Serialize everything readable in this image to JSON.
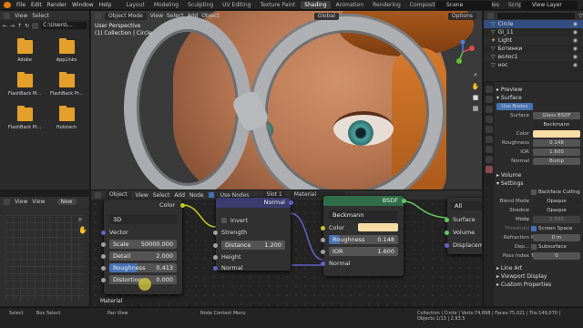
{
  "topbar": {
    "menus": [
      "File",
      "Edit",
      "Render",
      "Window",
      "Help"
    ],
    "workspaces": [
      "Layout",
      "Modeling",
      "Sculpting",
      "UV Editing",
      "Texture Paint",
      "Shading",
      "Animation",
      "Rendering",
      "Compositing",
      "Geometry Nodes",
      "Scripting"
    ],
    "active_workspace": "Shading",
    "scene": "Scene",
    "view_layer": "View Layer"
  },
  "file_browser": {
    "menus": [
      "View",
      "Select"
    ],
    "path": "C:\\Users\\...",
    "folders": [
      "Adobe",
      "AppLinks",
      "FlashBack M...",
      "FlashBack Pr...",
      "FlashBack Pr...",
      "Holotech"
    ]
  },
  "image_editor": {
    "menus": [
      "View",
      "View"
    ],
    "new_label": "New"
  },
  "viewport": {
    "mode": "Object Mode",
    "menus": [
      "View",
      "Select",
      "Add",
      "Object"
    ],
    "transform": "Global",
    "options": "Options",
    "info_line1": "User Perspective",
    "info_line2": "(1) Collection | Circle"
  },
  "node_editor": {
    "mode": "Object",
    "menus": [
      "View",
      "Select",
      "Add",
      "Node"
    ],
    "use_nodes": "Use Nodes",
    "slot": "Slot 1",
    "material": "Material",
    "footer_label": "Material",
    "noise_node": {
      "output": "Color",
      "type": "3D",
      "vector": "Vector",
      "scale_label": "Scale",
      "scale_value": "50000.000",
      "detail_label": "Detail",
      "detail_value": "2.000",
      "roughness_label": "Roughness",
      "roughness_value": "0.413",
      "distortion_label": "Distortion",
      "distortion_value": "0.000"
    },
    "bump_node": {
      "title": "Normal",
      "invert": "Invert",
      "strength": "Strength",
      "distance_label": "Distance",
      "distance_value": "1.200",
      "height": "Height",
      "normal": "Normal"
    },
    "bsdf_node": {
      "title": "BSDF",
      "distribution": "Beckmann",
      "color": "Color",
      "roughness_label": "Roughness",
      "roughness_value": "0.148",
      "ior_label": "IOR",
      "ior_value": "1.600",
      "normal": "Normal"
    },
    "output_node": {
      "target": "All",
      "surface": "Surface",
      "volume": "Volume",
      "displacement": "Displacement"
    }
  },
  "outliner": {
    "items": [
      "Circle",
      "GI_11",
      "Light",
      "Ботинки",
      "волос1",
      "нос"
    ]
  },
  "properties": {
    "preview": "Preview",
    "surface": "Surface",
    "use_nodes": "Use Nodes",
    "surface_label": "Surface",
    "surface_value": "Glass BSDF",
    "distribution": "Beckmann",
    "color_label": "Color",
    "color_swatch": "#f7dca6",
    "roughness_label": "Roughness",
    "roughness_value": "0.148",
    "ior_label": "IOR",
    "ior_value": "1.600",
    "normal_label": "Normal",
    "normal_value": "Bump",
    "volume": "Volume",
    "settings": "Settings",
    "backface": "Backface Culling",
    "blend_label": "Blend Mode",
    "blend_value": "Opaque",
    "shadow_label": "Shadow Mode",
    "shadow_value": "Opaque",
    "clip_label": "Clip Threshold",
    "clip_value": "0.500",
    "screen_space": "Screen Space Refr...",
    "refraction_label": "Refraction Dep...",
    "refraction_value": "0 m",
    "subsurface": "Subsurface Transl...",
    "pass_label": "Pass Index",
    "pass_value": "0",
    "line_art": "Line Art",
    "viewport_display": "Viewport Display",
    "custom_props": "Custom Properties"
  },
  "statusbar": {
    "select": "Select",
    "box_select": "Box Select",
    "pan_view": "Pan View",
    "node_context": "Node Context Menu",
    "stats": "Collection | Circle | Verts:74,898 | Faces:75,021 | Tris:149,070 | Objects:1/13 | 2.93.5"
  },
  "colors": {
    "accent": "#4772b3",
    "active_tab": "#3d3d3d",
    "folder": "#e4a02a",
    "socket_gray": "#a1a1a1",
    "socket_yellow": "#c7c729",
    "socket_purple": "#6363c7",
    "socket_green": "#63c763",
    "noise_header": "#7a3e3a",
    "vector_header": "#3b3b6d",
    "shader_header": "#2f6e48",
    "output_header": "#6b2222"
  }
}
